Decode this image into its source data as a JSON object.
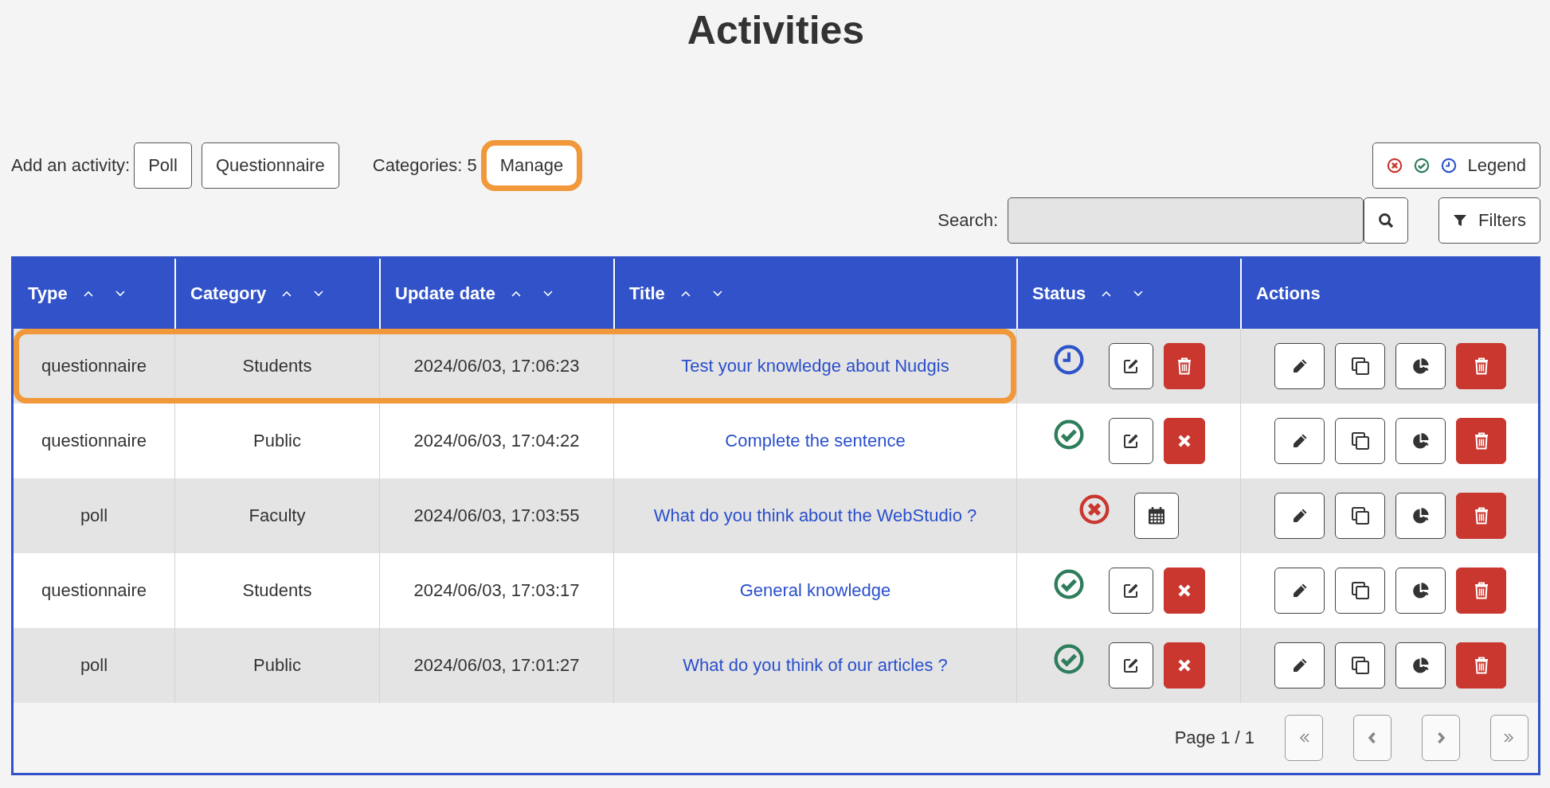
{
  "title": "Activities",
  "toolbar": {
    "add_label": "Add an activity:",
    "add_buttons": [
      "Poll",
      "Questionnaire"
    ],
    "categories_label": "Categories: 5",
    "manage": {
      "label": "Manage",
      "highlighted": true
    },
    "legend": {
      "icons": [
        {
          "kind": "inactive"
        },
        {
          "kind": "active"
        },
        {
          "kind": "scheduled"
        }
      ],
      "label": "Legend"
    }
  },
  "search": {
    "label": "Search:",
    "filters_label": "Filters"
  },
  "table": {
    "columns": [
      {
        "label": "Type",
        "sortable": true
      },
      {
        "label": "Category",
        "sortable": true
      },
      {
        "label": "Update date",
        "sortable": true
      },
      {
        "label": "Title",
        "sortable": true
      },
      {
        "label": "Status",
        "sortable": true
      },
      {
        "label": "Actions",
        "sortable": false
      }
    ],
    "rows": [
      {
        "type": "questionnaire",
        "category": "Students",
        "update_date": "2024/06/03, 17:06:23",
        "title": "Test your knowledge about Nudgis",
        "highlighted": true,
        "status": {
          "kind": "scheduled"
        },
        "status_actions": [
          {
            "kind": "edit_settings"
          },
          {
            "kind": "delete"
          }
        ],
        "actions": [
          {
            "kind": "edit"
          },
          {
            "kind": "copy"
          },
          {
            "kind": "stats"
          },
          {
            "kind": "delete"
          }
        ]
      },
      {
        "type": "questionnaire",
        "category": "Public",
        "update_date": "2024/06/03, 17:04:22",
        "title": "Complete the sentence",
        "highlighted": false,
        "status": {
          "kind": "active"
        },
        "status_actions": [
          {
            "kind": "edit_settings"
          },
          {
            "kind": "deactivate"
          }
        ],
        "actions": [
          {
            "kind": "edit"
          },
          {
            "kind": "copy"
          },
          {
            "kind": "stats"
          },
          {
            "kind": "delete"
          }
        ]
      },
      {
        "type": "poll",
        "category": "Faculty",
        "update_date": "2024/06/03, 17:03:55",
        "title": "What do you think about the WebStudio ?",
        "highlighted": false,
        "status": {
          "kind": "inactive"
        },
        "status_actions": [
          {
            "kind": "schedule"
          }
        ],
        "actions": [
          {
            "kind": "edit"
          },
          {
            "kind": "copy"
          },
          {
            "kind": "stats"
          },
          {
            "kind": "delete"
          }
        ]
      },
      {
        "type": "questionnaire",
        "category": "Students",
        "update_date": "2024/06/03, 17:03:17",
        "title": "General knowledge",
        "highlighted": false,
        "status": {
          "kind": "active"
        },
        "status_actions": [
          {
            "kind": "edit_settings"
          },
          {
            "kind": "deactivate"
          }
        ],
        "actions": [
          {
            "kind": "edit"
          },
          {
            "kind": "copy"
          },
          {
            "kind": "stats"
          },
          {
            "kind": "delete"
          }
        ]
      },
      {
        "type": "poll",
        "category": "Public",
        "update_date": "2024/06/03, 17:01:27",
        "title": "What do you think of our articles ?",
        "highlighted": false,
        "status": {
          "kind": "active"
        },
        "status_actions": [
          {
            "kind": "edit_settings"
          },
          {
            "kind": "deactivate"
          }
        ],
        "actions": [
          {
            "kind": "edit"
          },
          {
            "kind": "copy"
          },
          {
            "kind": "stats"
          },
          {
            "kind": "delete"
          }
        ]
      }
    ]
  },
  "pagination": {
    "label": "Page 1 / 1",
    "buttons": [
      {
        "kind": "first",
        "disabled": true
      },
      {
        "kind": "previous",
        "disabled": true
      },
      {
        "kind": "next",
        "disabled": true
      },
      {
        "kind": "last",
        "disabled": true
      }
    ]
  }
}
